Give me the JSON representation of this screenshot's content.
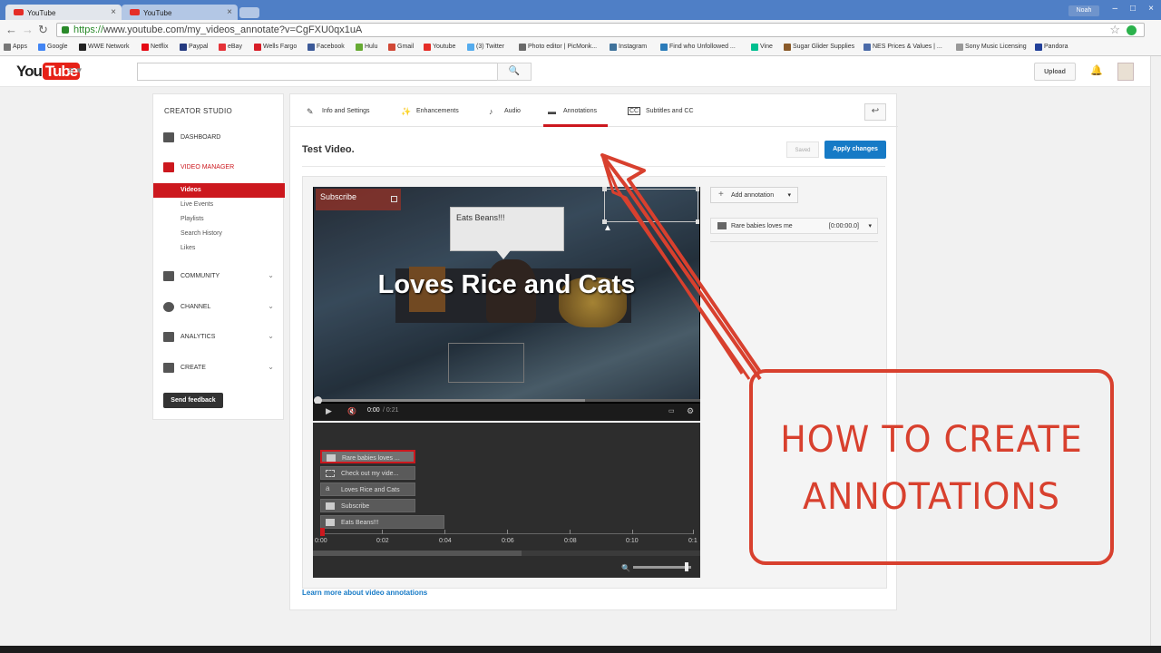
{
  "browser": {
    "tabs": [
      {
        "label": "YouTube",
        "close": "×"
      },
      {
        "label": "YouTube",
        "close": "×"
      }
    ],
    "user": "Noah",
    "window_controls": [
      "–",
      "□",
      "×"
    ],
    "nav": {
      "back": "←",
      "forward": "→",
      "reload": "↻"
    },
    "url_https": "https://",
    "url_rest": "www.youtube.com/my_videos_annotate?v=CgFXU0qx1uA",
    "bookmarks": [
      {
        "label": "Apps",
        "color": "#777777"
      },
      {
        "label": "Google",
        "color": "#4285f4"
      },
      {
        "label": "WWE Network",
        "color": "#222222"
      },
      {
        "label": "Netflix",
        "color": "#e50914"
      },
      {
        "label": "Paypal",
        "color": "#253b80"
      },
      {
        "label": "eBay",
        "color": "#e53238"
      },
      {
        "label": "Wells Fargo",
        "color": "#d71e28"
      },
      {
        "label": "Facebook",
        "color": "#3b5998"
      },
      {
        "label": "Hulu",
        "color": "#66aa33"
      },
      {
        "label": "Gmail",
        "color": "#d14836"
      },
      {
        "label": "Youtube",
        "color": "#e52d27"
      },
      {
        "label": "(3) Twitter",
        "color": "#55acee"
      },
      {
        "label": "Photo editor | PicMonk...",
        "color": "#6a6a6a"
      },
      {
        "label": "Instagram",
        "color": "#3f729b"
      },
      {
        "label": "Find who Unfollowed ...",
        "color": "#2b7bb9"
      },
      {
        "label": "Vine",
        "color": "#00bf8f"
      },
      {
        "label": "Sugar Glider Supplies",
        "color": "#8a5a2a"
      },
      {
        "label": "NES Prices & Values | ...",
        "color": "#4a6aa8"
      },
      {
        "label": "Sony Music Licensing",
        "color": "#999999"
      },
      {
        "label": "Pandora",
        "color": "#224099"
      }
    ]
  },
  "masthead": {
    "logo_you": "You",
    "logo_tube": "Tube",
    "guide_icon": "≡ ▾",
    "search_icon": "🔍",
    "upload": "Upload",
    "bell": "🔔"
  },
  "sidebar": {
    "title": "CREATOR STUDIO",
    "items": [
      {
        "label": "DASHBOARD",
        "icon": "dashboard-icon"
      },
      {
        "label": "VIDEO MANAGER",
        "icon": "video-manager-icon"
      },
      {
        "label": "COMMUNITY",
        "icon": "community-icon"
      },
      {
        "label": "CHANNEL",
        "icon": "channel-icon"
      },
      {
        "label": "ANALYTICS",
        "icon": "analytics-icon"
      },
      {
        "label": "CREATE",
        "icon": "create-icon"
      }
    ],
    "subitems": [
      "Videos",
      "Live Events",
      "Playlists",
      "Search History",
      "Likes"
    ],
    "chevron": "⌄",
    "send_feedback": "Send feedback"
  },
  "main": {
    "tabs": [
      {
        "label": "Info and Settings",
        "icon": "✎"
      },
      {
        "label": "Enhancements",
        "icon": "✨"
      },
      {
        "label": "Audio",
        "icon": "♪"
      },
      {
        "label": "Annotations",
        "icon": "▬"
      },
      {
        "label": "Subtitles and CC",
        "icon": "CC"
      }
    ],
    "back_icon": "↩",
    "video_title": "Test Video.",
    "saved": "Saved",
    "apply": "Apply changes",
    "learn_more": "Learn more about video annotations"
  },
  "player": {
    "ann_subscribe": "Subscribe",
    "ann_speech": "Eats Beans!!!",
    "ann_title": "Loves Rice and Cats",
    "play": "▶",
    "mute": "🔇",
    "time_current": "0:00",
    "time_total": "/ 0:21",
    "cc": "▭",
    "settings": "⚙",
    "buffered_fraction": 0.7
  },
  "timeline": {
    "bars": [
      {
        "label": "Rare babies loves ...",
        "selected": true
      },
      {
        "label": "Check out my vide...",
        "selected": false
      },
      {
        "label": "Loves Rice and Cats",
        "selected": false
      },
      {
        "label": "Subscribe",
        "selected": false
      },
      {
        "label": "Eats Beans!!!",
        "selected": false
      }
    ],
    "ticks": [
      "0:00",
      "0:02",
      "0:04",
      "0:06",
      "0:08",
      "0:10",
      "0:1"
    ],
    "zoom_icon": "🔍"
  },
  "annotations_panel": {
    "add": "Add annotation",
    "plus": "+",
    "caret": "▾",
    "item_label": "Rare babies loves me",
    "item_time": "[0:00:00.0]"
  },
  "overlay": {
    "line1": "HOW TO CREATE",
    "line2": "ANNOTATIONS",
    "color": "#d8402e"
  }
}
